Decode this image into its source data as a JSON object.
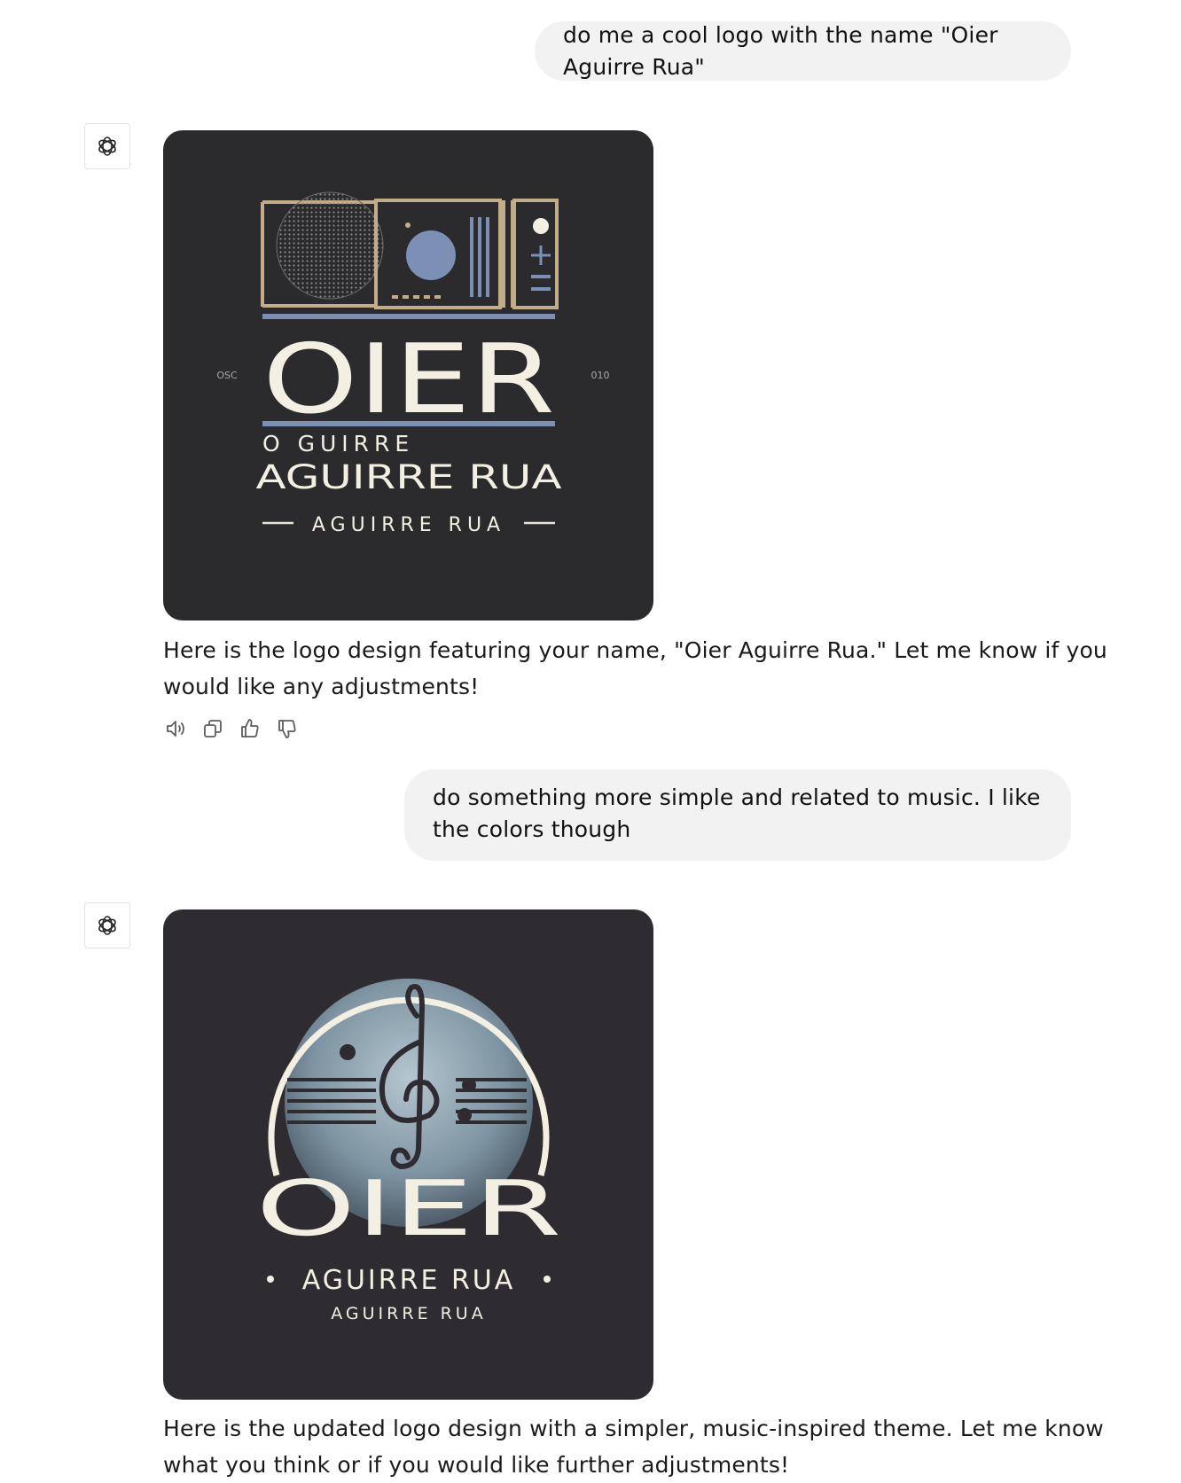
{
  "conversation": [
    {
      "role": "user",
      "text": "do me a cool logo with the name \"Oier Aguirre Rua\""
    },
    {
      "role": "assistant",
      "image": {
        "title": "OIER",
        "line1": "O GUIRRE",
        "line2": "AGUIRRE RUA",
        "line3": "AGUIRRE RUA",
        "side_left": "OSC",
        "side_right": "010"
      },
      "text": "Here is the logo design featuring your name, \"Oier Aguirre Rua.\" Let me know if you would like any adjustments!"
    },
    {
      "role": "user",
      "text": "do something more simple and related to music. I like the colors though"
    },
    {
      "role": "assistant",
      "image": {
        "title": "OIER",
        "line1": "AGUIRRE RUA",
        "line2": "AGUIRRE   RUA"
      },
      "text": "Here is the updated logo design with a simpler, music-inspired theme. Let me know what you think or if you would like further adjustments!"
    }
  ],
  "actions": [
    {
      "icon": "speaker-icon"
    },
    {
      "icon": "copy-icon"
    },
    {
      "icon": "thumbs-up-icon"
    },
    {
      "icon": "thumbs-down-icon"
    }
  ],
  "colors": {
    "user_bubble": "#f2f2f2",
    "image_bg": "#2b2a2d",
    "gold": "#c2ad88",
    "blue": "#7c90b5",
    "cream": "#f3efe3"
  }
}
